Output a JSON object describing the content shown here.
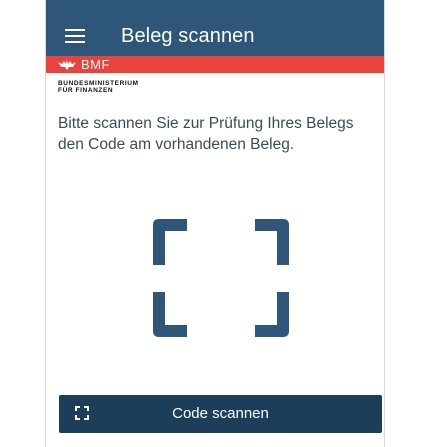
{
  "header": {
    "title": "Beleg scannen",
    "menu_icon": "hamburger-menu-icon"
  },
  "brand": {
    "bmf_label": "BMF",
    "ministry_line1": "BUNDESMINISTERIUM",
    "ministry_line2": "FÜR FINANZEN",
    "crest_icon": "eagle-crest-icon"
  },
  "main": {
    "instruction": "Bitte scannen Sie zur Prüfung Ihres Belegs den Code am vorhandenen Beleg.",
    "scan_frame_icon": "scan-frame-icon"
  },
  "footer": {
    "scan_button_label": "Code scannen",
    "scan_button_icon": "qr-scan-icon"
  },
  "colors": {
    "header_bg": "#2e5678",
    "accent_red": "#e8433d",
    "button_bg": "#1d3e5b",
    "scan_frame": "#2e5678"
  }
}
